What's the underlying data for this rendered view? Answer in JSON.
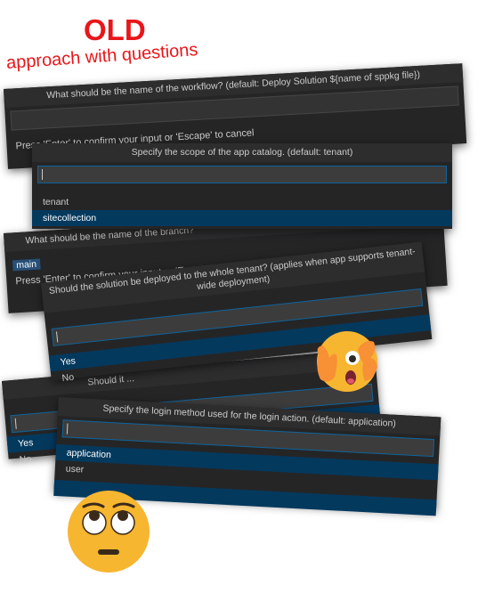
{
  "heading": {
    "old": "OLD",
    "sub": "approach with questions"
  },
  "panel_workflow": {
    "title": "What should be the name of the workflow? (default: Deploy Solution ${name of sppkg file})",
    "hint": "Press 'Enter' to confirm your input or 'Escape' to cancel"
  },
  "panel_scope": {
    "title": "Specify the scope of the app catalog. (default: tenant)",
    "options": [
      "tenant",
      "sitecollection"
    ],
    "selected": "sitecollection"
  },
  "panel_branch": {
    "title": "What should be the name of the branch?",
    "input_value": "main",
    "hint": "Press 'Enter' to confirm your input or 'Escape' to cancel"
  },
  "panel_tenantwide": {
    "title": "Should the solution be deployed to the whole tenant? (applies when app supports tenant-wide deployment)",
    "options": [
      "Yes",
      "No"
    ],
    "selected": "Yes"
  },
  "panel_skip": {
    "title": "Should it ...",
    "options": [
      "Yes",
      "No"
    ],
    "selected": "Yes"
  },
  "panel_login": {
    "title": "Specify the login method used for the login action. (default: application)",
    "options": [
      "application",
      "user"
    ],
    "selected": "application"
  },
  "emojis": [
    "peeking-face-emoji",
    "eye-roll-face-emoji"
  ]
}
